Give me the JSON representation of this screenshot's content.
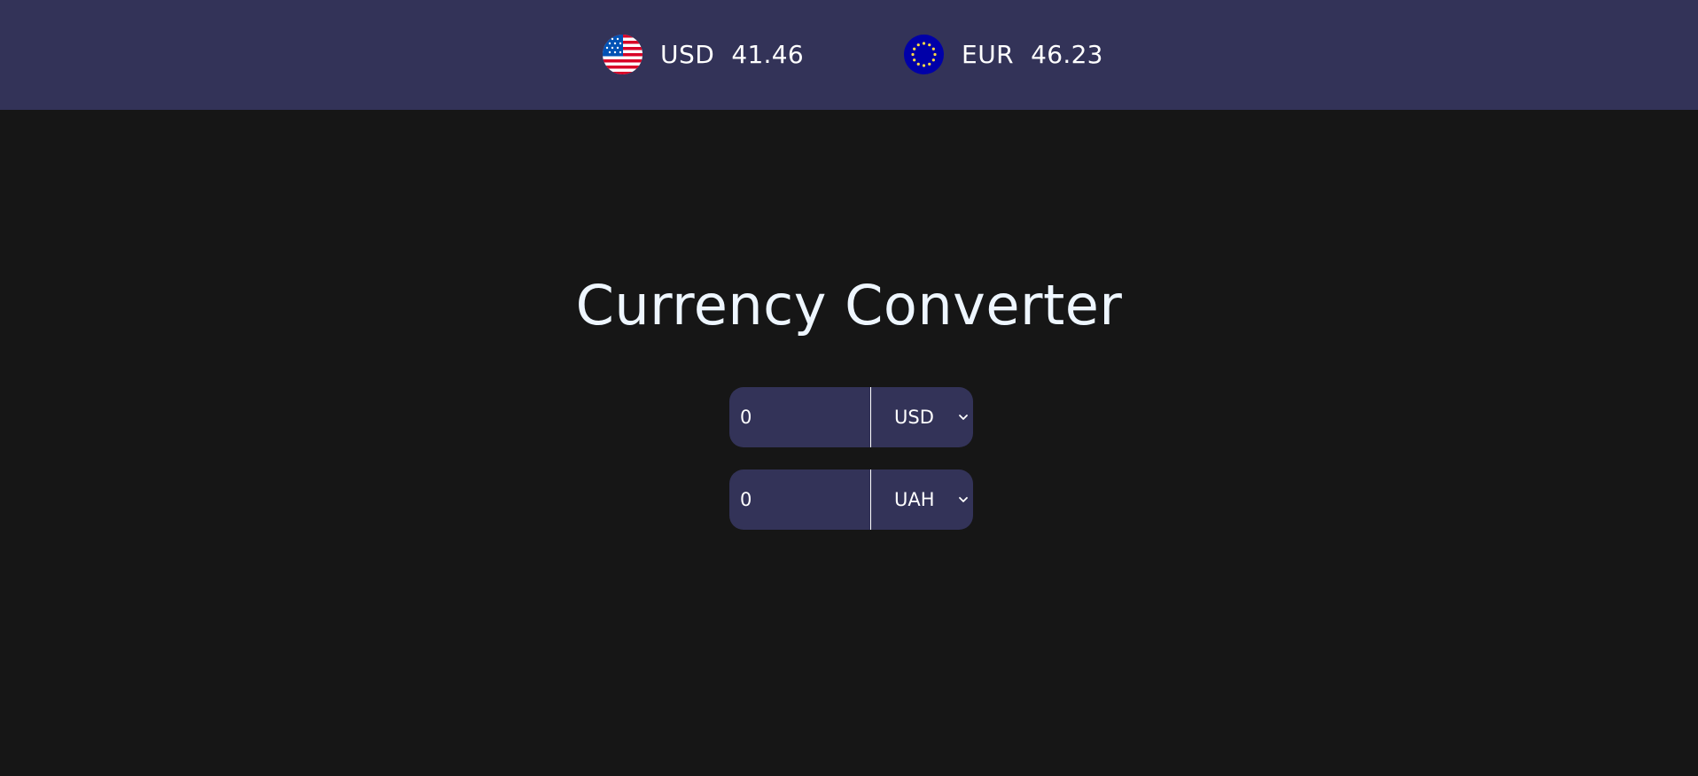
{
  "header": {
    "rates": [
      {
        "code": "USD",
        "value": "41.46",
        "icon": "us-flag-icon"
      },
      {
        "code": "EUR",
        "value": "46.23",
        "icon": "eu-flag-icon"
      }
    ]
  },
  "main": {
    "title": "Currency Converter",
    "converter": [
      {
        "amount": "0",
        "currency": "USD"
      },
      {
        "amount": "0",
        "currency": "UAH"
      }
    ]
  },
  "colors": {
    "background": "#161616",
    "header": "#333358",
    "field": "#333358",
    "text": "#ffffff",
    "title": "#eef6ff"
  }
}
